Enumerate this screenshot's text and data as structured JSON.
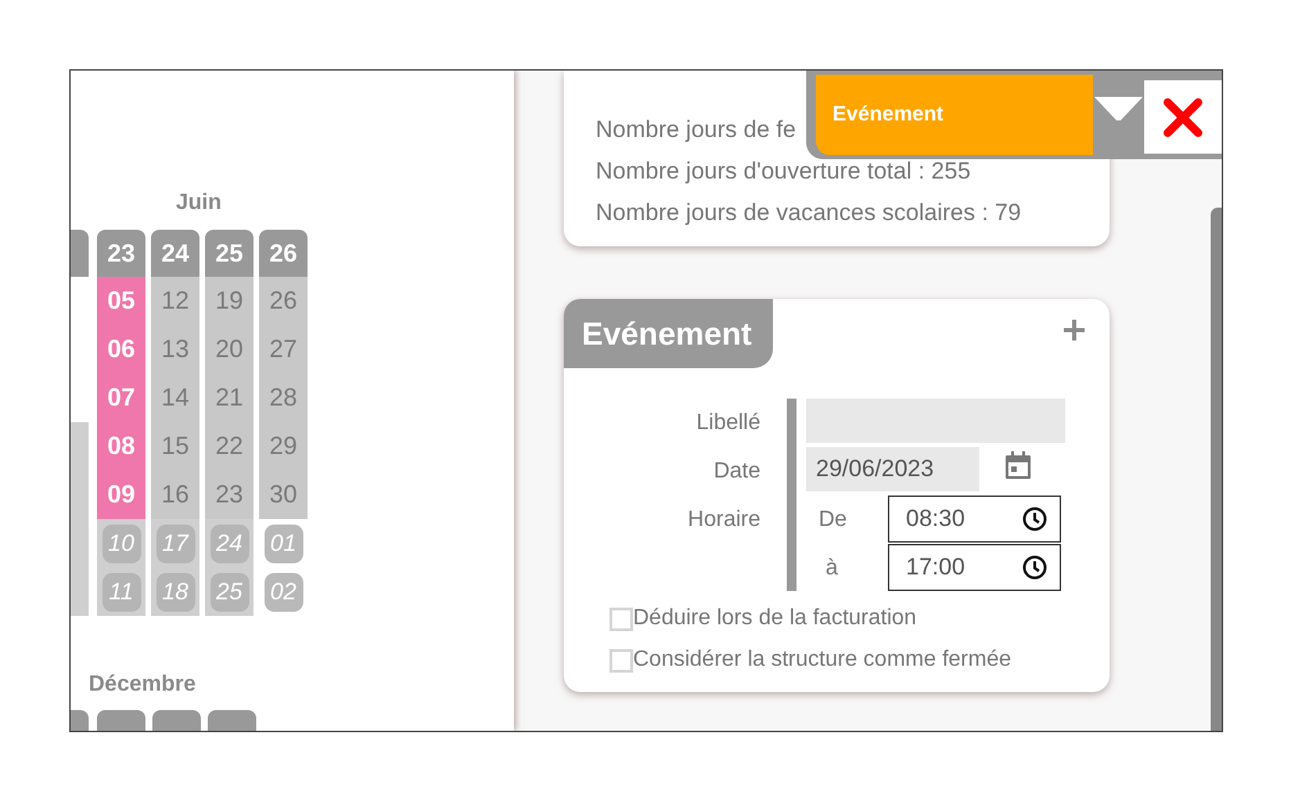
{
  "calendar": {
    "months": [
      {
        "label": "Juin"
      },
      {
        "label": "Décembre"
      }
    ],
    "weeks": [
      {
        "number": "23",
        "days": [
          {
            "label": "05",
            "highlighted": true
          },
          {
            "label": "06",
            "highlighted": true
          },
          {
            "label": "07",
            "highlighted": true
          },
          {
            "label": "08",
            "highlighted": true
          },
          {
            "label": "09",
            "highlighted": true
          }
        ],
        "weekend": [
          {
            "label": "10",
            "other_month": false
          },
          {
            "label": "11",
            "other_month": false
          }
        ]
      },
      {
        "number": "24",
        "days": [
          {
            "label": "12",
            "highlighted": false
          },
          {
            "label": "13",
            "highlighted": false
          },
          {
            "label": "14",
            "highlighted": false
          },
          {
            "label": "15",
            "highlighted": false
          },
          {
            "label": "16",
            "highlighted": false
          }
        ],
        "weekend": [
          {
            "label": "17",
            "other_month": false
          },
          {
            "label": "18",
            "other_month": false
          }
        ]
      },
      {
        "number": "25",
        "days": [
          {
            "label": "19",
            "highlighted": false
          },
          {
            "label": "20",
            "highlighted": false
          },
          {
            "label": "21",
            "highlighted": false
          },
          {
            "label": "22",
            "highlighted": false
          },
          {
            "label": "23",
            "highlighted": false
          }
        ],
        "weekend": [
          {
            "label": "24",
            "other_month": false
          },
          {
            "label": "25",
            "other_month": false
          }
        ]
      },
      {
        "number": "26",
        "days": [
          {
            "label": "26",
            "highlighted": false
          },
          {
            "label": "27",
            "highlighted": false
          },
          {
            "label": "28",
            "highlighted": false
          },
          {
            "label": "29",
            "highlighted": false
          },
          {
            "label": "30",
            "highlighted": false
          }
        ],
        "weekend": [
          {
            "label": "01",
            "other_month": true
          },
          {
            "label": "02",
            "other_month": true
          }
        ]
      }
    ]
  },
  "stats": [
    "Nombre jours de fe",
    "Nombre jours d'ouverture total : 255",
    "Nombre jours de vacances scolaires : 79"
  ],
  "overlay": {
    "title": "Evénement"
  },
  "event_card": {
    "title": "Evénement",
    "fields": [
      {
        "label": "Libellé"
      },
      {
        "label": "Date",
        "value": "29/06/2023"
      },
      {
        "label": "Horaire"
      }
    ],
    "time_from": {
      "label": "De",
      "value": "08:30"
    },
    "time_to": {
      "label": "à",
      "value": "17:00"
    },
    "checkboxes": [
      {
        "label": "Déduire lors de la facturation",
        "checked": false
      },
      {
        "label": "Considérer la structure comme fermée",
        "checked": false
      }
    ]
  }
}
